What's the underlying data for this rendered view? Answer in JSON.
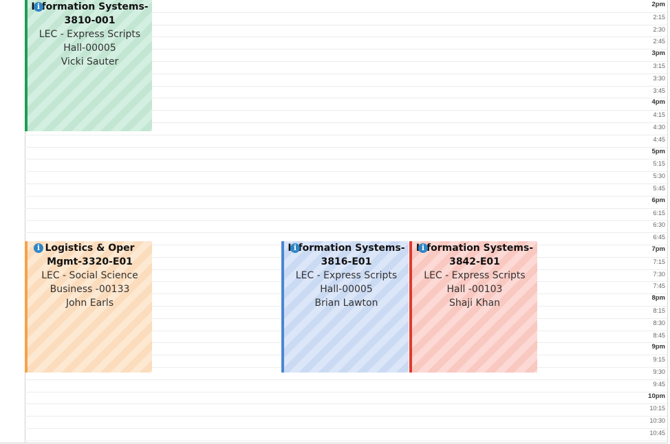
{
  "time_slots": [
    {
      "label": "2pm",
      "hour": true
    },
    {
      "label": "2:15"
    },
    {
      "label": "2:30"
    },
    {
      "label": "2:45"
    },
    {
      "label": "3pm",
      "hour": true
    },
    {
      "label": "3:15"
    },
    {
      "label": "3:30"
    },
    {
      "label": "3:45"
    },
    {
      "label": "4pm",
      "hour": true
    },
    {
      "label": "4:15"
    },
    {
      "label": "4:30"
    },
    {
      "label": "4:45"
    },
    {
      "label": "5pm",
      "hour": true
    },
    {
      "label": "5:15"
    },
    {
      "label": "5:30"
    },
    {
      "label": "5:45"
    },
    {
      "label": "6pm",
      "hour": true
    },
    {
      "label": "6:15"
    },
    {
      "label": "6:30"
    },
    {
      "label": "6:45"
    },
    {
      "label": "7pm",
      "hour": true
    },
    {
      "label": "7:15"
    },
    {
      "label": "7:30"
    },
    {
      "label": "7:45"
    },
    {
      "label": "8pm",
      "hour": true
    },
    {
      "label": "8:15"
    },
    {
      "label": "8:30"
    },
    {
      "label": "8:45"
    },
    {
      "label": "9pm",
      "hour": true
    },
    {
      "label": "9:15"
    },
    {
      "label": "9:30"
    },
    {
      "label": "9:45"
    },
    {
      "label": "10pm",
      "hour": true
    },
    {
      "label": "10:15"
    },
    {
      "label": "10:30"
    },
    {
      "label": "10:45"
    }
  ],
  "events": [
    {
      "title": "Information Systems-3810-001",
      "location": "LEC - Express Scripts Hall-00005",
      "instructor": "Vicki Sauter",
      "bg_color": "#d3efe1",
      "stripe_color": "#c3e6d3",
      "border_color": "#1f9c55",
      "icon": "info-icon"
    },
    {
      "title": "Logistics & Oper Mgmt-3320-E01",
      "location": "LEC - Social Science Business -00133",
      "instructor": "John Earls",
      "bg_color": "#fde8d1",
      "stripe_color": "#fbdcbc",
      "border_color": "#f5a24a",
      "icon": "info-icon"
    },
    {
      "title": "Information Systems-3816-E01",
      "location": "LEC - Express Scripts Hall-00005",
      "instructor": "Brian Lawton",
      "bg_color": "#dbe6f8",
      "stripe_color": "#cbdaf3",
      "border_color": "#4a86d4",
      "icon": "info-icon"
    },
    {
      "title": "Information Systems-3842-E01",
      "location": "LEC - Express Scripts Hall -00103",
      "instructor": "Shaji Khan",
      "bg_color": "#fcd9d4",
      "stripe_color": "#f8c8c1",
      "border_color": "#e0392b",
      "icon": "info-icon"
    }
  ]
}
